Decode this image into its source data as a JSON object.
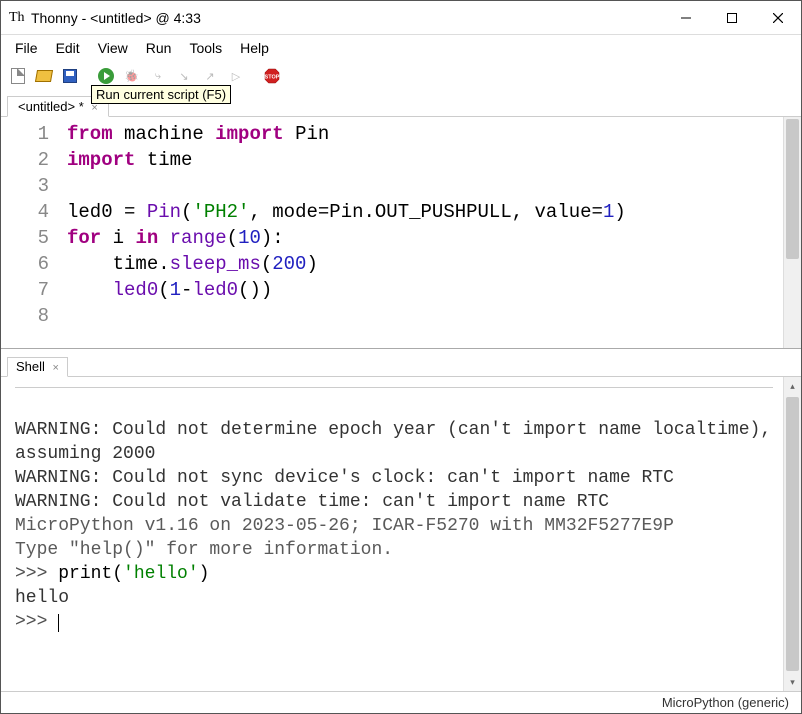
{
  "window": {
    "title": "Thonny  -  <untitled>  @ 4:33",
    "app_icon_label": "Th"
  },
  "menu": {
    "items": [
      "File",
      "Edit",
      "View",
      "Run",
      "Tools",
      "Help"
    ]
  },
  "toolbar": {
    "tooltip": "Run current script (F5)"
  },
  "editor": {
    "tab_label": "<untitled> *",
    "line_numbers": [
      "1",
      "2",
      "3",
      "4",
      "5",
      "6",
      "7",
      "8"
    ],
    "lines": [
      {
        "tokens": [
          {
            "t": "from",
            "c": "kw"
          },
          {
            "t": " ",
            "c": "nm"
          },
          {
            "t": "machine",
            "c": "nm"
          },
          {
            "t": " ",
            "c": "nm"
          },
          {
            "t": "import",
            "c": "kw"
          },
          {
            "t": " ",
            "c": "nm"
          },
          {
            "t": "Pin",
            "c": "nm"
          }
        ]
      },
      {
        "tokens": [
          {
            "t": "import",
            "c": "kw"
          },
          {
            "t": " ",
            "c": "nm"
          },
          {
            "t": "time",
            "c": "nm"
          }
        ]
      },
      {
        "tokens": []
      },
      {
        "tokens": [
          {
            "t": "led0 ",
            "c": "nm"
          },
          {
            "t": "=",
            "c": "op"
          },
          {
            "t": " ",
            "c": "nm"
          },
          {
            "t": "Pin",
            "c": "fn"
          },
          {
            "t": "(",
            "c": "op"
          },
          {
            "t": "'PH2'",
            "c": "str"
          },
          {
            "t": ", mode",
            "c": "nm"
          },
          {
            "t": "=",
            "c": "op"
          },
          {
            "t": "Pin.OUT_PUSHPULL, value",
            "c": "nm"
          },
          {
            "t": "=",
            "c": "op"
          },
          {
            "t": "1",
            "c": "num"
          },
          {
            "t": ")",
            "c": "op"
          }
        ]
      },
      {
        "tokens": [
          {
            "t": "for",
            "c": "kw"
          },
          {
            "t": " i ",
            "c": "nm"
          },
          {
            "t": "in",
            "c": "kw"
          },
          {
            "t": " ",
            "c": "nm"
          },
          {
            "t": "range",
            "c": "fn"
          },
          {
            "t": "(",
            "c": "op"
          },
          {
            "t": "10",
            "c": "num"
          },
          {
            "t": "):",
            "c": "op"
          }
        ]
      },
      {
        "tokens": [
          {
            "t": "    time.",
            "c": "nm"
          },
          {
            "t": "sleep_ms",
            "c": "fn"
          },
          {
            "t": "(",
            "c": "op"
          },
          {
            "t": "200",
            "c": "num"
          },
          {
            "t": ")",
            "c": "op"
          }
        ]
      },
      {
        "tokens": [
          {
            "t": "    ",
            "c": "nm"
          },
          {
            "t": "led0",
            "c": "fn"
          },
          {
            "t": "(",
            "c": "op"
          },
          {
            "t": "1",
            "c": "num"
          },
          {
            "t": "-",
            "c": "op"
          },
          {
            "t": "led0",
            "c": "fn"
          },
          {
            "t": "())",
            "c": "op"
          }
        ]
      },
      {
        "tokens": []
      }
    ]
  },
  "shell": {
    "tab_label": "Shell",
    "lines": [
      {
        "kind": "rule"
      },
      {
        "kind": "blank"
      },
      {
        "kind": "warn",
        "text": "WARNING: Could not determine epoch year (can't import name localtime), assuming 2000"
      },
      {
        "kind": "warn",
        "text": "WARNING: Could not sync device's clock: can't import name RTC"
      },
      {
        "kind": "warn",
        "text": "WARNING: Could not validate time: can't import name RTC"
      },
      {
        "kind": "info",
        "text": "MicroPython v1.16 on 2023-05-26; ICAR-F5270 with MM32F5277E9P"
      },
      {
        "kind": "info",
        "text": "Type \"help()\" for more information."
      },
      {
        "kind": "input",
        "prompt": ">>> ",
        "tokens": [
          {
            "t": "print",
            "c": "usr-fn"
          },
          {
            "t": "(",
            "c": "usr-fn"
          },
          {
            "t": "'hello'",
            "c": "usr-str"
          },
          {
            "t": ")",
            "c": "usr-fn"
          }
        ]
      },
      {
        "kind": "out",
        "text": "hello"
      },
      {
        "kind": "prompt",
        "prompt": ">>> "
      }
    ]
  },
  "status": {
    "interpreter": "MicroPython (generic)"
  }
}
